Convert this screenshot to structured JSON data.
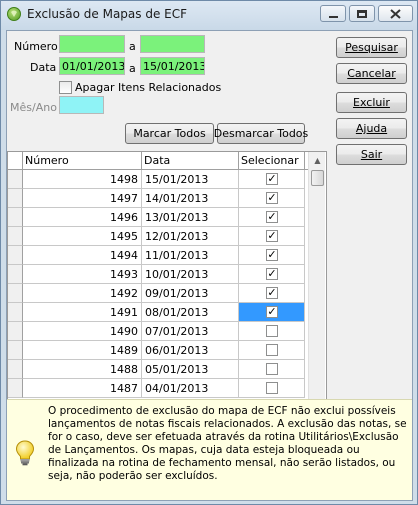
{
  "window": {
    "title": "Exclusão de Mapas de ECF"
  },
  "filters": {
    "numero_label": "Número",
    "numero_from": "",
    "numero_sep": "a",
    "numero_to": "",
    "data_label": "Data",
    "data_from": "01/01/2013",
    "data_sep": "a",
    "data_to": "15/01/2013",
    "apagar_label": "Apagar Itens Relacionados",
    "apagar_checked": false,
    "mesano_label": "Mês/Ano",
    "mesano_value": ""
  },
  "buttons": {
    "marcar_todos": "Marcar Todos",
    "desmarcar_todos": "Desmarcar Todos",
    "pesquisar": "Pesquisar",
    "cancelar": "Cancelar",
    "excluir": "Excluir",
    "ajuda": "Ajuda",
    "sair": "Sair"
  },
  "grid": {
    "columns": [
      "Número",
      "Data",
      "Selecionar"
    ],
    "rows": [
      {
        "numero": "1498",
        "data": "15/01/2013",
        "selected": true
      },
      {
        "numero": "1497",
        "data": "14/01/2013",
        "selected": true
      },
      {
        "numero": "1496",
        "data": "13/01/2013",
        "selected": true
      },
      {
        "numero": "1495",
        "data": "12/01/2013",
        "selected": true
      },
      {
        "numero": "1494",
        "data": "11/01/2013",
        "selected": true
      },
      {
        "numero": "1493",
        "data": "10/01/2013",
        "selected": true
      },
      {
        "numero": "1492",
        "data": "09/01/2013",
        "selected": true
      },
      {
        "numero": "1491",
        "data": "08/01/2013",
        "selected": true
      },
      {
        "numero": "1490",
        "data": "07/01/2013",
        "selected": false
      },
      {
        "numero": "1489",
        "data": "06/01/2013",
        "selected": false
      },
      {
        "numero": "1488",
        "data": "05/01/2013",
        "selected": false
      },
      {
        "numero": "1487",
        "data": "04/01/2013",
        "selected": false
      }
    ],
    "active_row": 7
  },
  "info": {
    "text": "O procedimento de exclusão do mapa de ECF não exclui possíveis lançamentos de notas fiscais relacionados. A exclusão das notas, se for o caso, deve ser efetuada através da rotina Utilitários\\Exclusão de Lançamentos. Os mapas, cuja data esteja bloqueada ou finalizada na rotina de fechamento mensal, não serão listados, ou seja, não poderão ser excluídos."
  },
  "colors": {
    "field_green": "#7bf27b",
    "field_cyan": "#8ff3f6",
    "selection_blue": "#3399ff",
    "info_background": "#ffffe1"
  }
}
